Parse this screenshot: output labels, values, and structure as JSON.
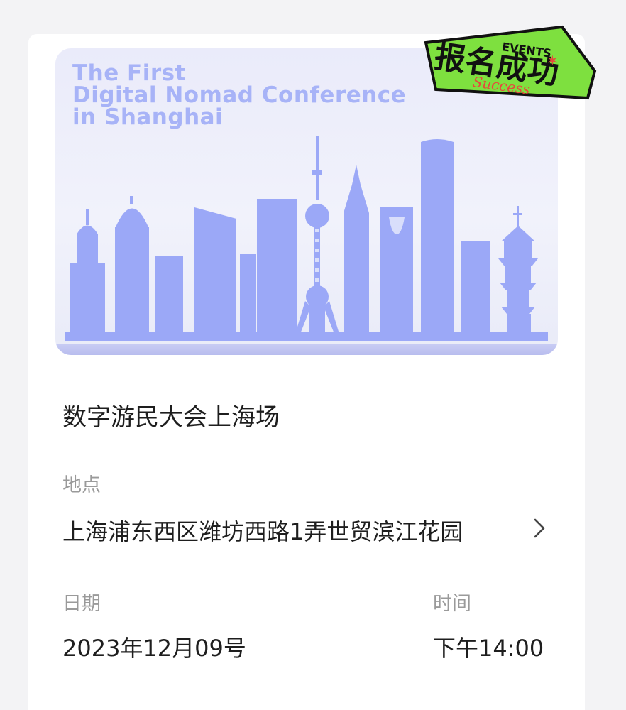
{
  "banner": {
    "title_lines": [
      "The First",
      "Digital Nomad Conference",
      "in Shanghai"
    ],
    "badge": {
      "text": "报名成功",
      "tag": "EVENTS",
      "subtext": "Success"
    },
    "colors": {
      "skyline": "#9ba8f7",
      "title": "#a7b3f7",
      "badge_green": "#7ee03f",
      "badge_red": "#e8473c"
    }
  },
  "event": {
    "name": "数字游民大会上海场",
    "location_label": "地点",
    "location_value": "上海浦东西区潍坊西路1弄世贸滨江花园",
    "location_icon": "chevron-right-icon",
    "date_label": "日期",
    "date_value": "2023年12月09号",
    "time_label": "时间",
    "time_value": "下午14:00"
  }
}
